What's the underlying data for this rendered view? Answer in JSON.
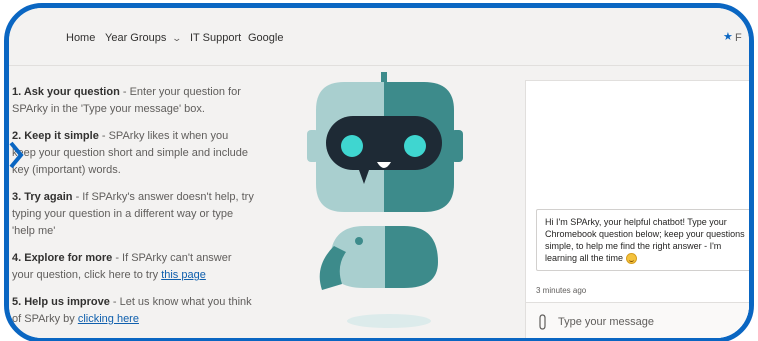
{
  "nav": {
    "items": [
      "Home",
      "Year Groups",
      "IT Support",
      "Google"
    ],
    "year_groups_chevron": "chevron-down-icon",
    "favorite_text": "F"
  },
  "instructions": [
    {
      "num_title": "1. Ask your question",
      "text": " - Enter your question for SPArky in the 'Type your message' box."
    },
    {
      "num_title": "2. Keep it simple",
      "text": " -  SPArky likes it when you keep your question short and simple and include key (important) words."
    },
    {
      "num_title": "3. Try again",
      "text": " - If SPArky's answer doesn't help, try typing your question in a different way or type 'help me'"
    },
    {
      "num_title": "4. Explore for more",
      "text": " - If SPArky can't answer your question, click here to try ",
      "link": "this page"
    },
    {
      "num_title": "5. Help us improve",
      "text": " -  Let us know what you think of SPArky by ",
      "link": "clicking here"
    }
  ],
  "chat": {
    "bot_message": "Hi I'm SPArky, your helpful chatbot! Type your Chromebook question below; keep your questions simple, to help me find the right answer - I'm learning all the time",
    "timestamp": "3 minutes ago",
    "input_placeholder": "Type your message",
    "send_symbol": "⊳"
  },
  "colors": {
    "frame_border": "#0a66c2",
    "robot_light": "#a9cfcf",
    "robot_dark": "#3d8b8b",
    "robot_face": "#1e2a35",
    "robot_eyes": "#3fd6d0"
  }
}
